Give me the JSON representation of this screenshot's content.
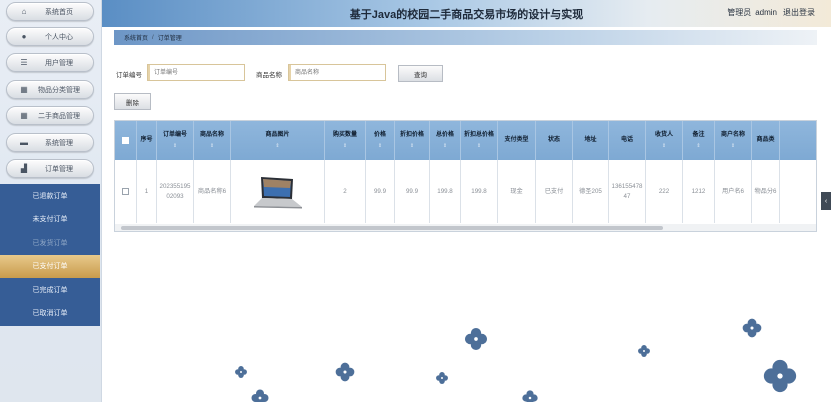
{
  "header": {
    "title": "基于Java的校园二手商品交易市场的设计与实现",
    "user_role": "管理员",
    "username": "admin",
    "logout": "退出登录"
  },
  "sidebar": {
    "items": [
      {
        "label": "系统首页",
        "icon": "home-icon"
      },
      {
        "label": "个人中心",
        "icon": "person-icon"
      },
      {
        "label": "用户管理",
        "icon": "list-icon"
      },
      {
        "label": "物品分类管理",
        "icon": "grid-icon"
      },
      {
        "label": "二手商品管理",
        "icon": "grid-icon"
      },
      {
        "label": "系统管理",
        "icon": "briefcase-icon"
      },
      {
        "label": "订单管理",
        "icon": "chart-icon"
      }
    ],
    "submenu": [
      {
        "label": "已退款订单"
      },
      {
        "label": "未支付订单"
      },
      {
        "label": "已发货订单"
      },
      {
        "label": "已支付订单"
      },
      {
        "label": "已完成订单"
      },
      {
        "label": "已取消订单"
      }
    ]
  },
  "breadcrumb": {
    "home": "系统首页",
    "separator": "/",
    "current": "订单管理"
  },
  "search": {
    "order_label": "订单编号",
    "order_placeholder": "订单编号",
    "name_label": "商品名称",
    "name_placeholder": "商品名称",
    "query_button": "查询",
    "delete_button": "删除"
  },
  "table": {
    "headers": [
      {
        "label": "",
        "sortable": false
      },
      {
        "label": "序号",
        "sortable": false
      },
      {
        "label": "订单编号",
        "sortable": true
      },
      {
        "label": "商品名称",
        "sortable": true
      },
      {
        "label": "商品图片",
        "sortable": true
      },
      {
        "label": "购买数量",
        "sortable": true
      },
      {
        "label": "价格",
        "sortable": true
      },
      {
        "label": "折扣价格",
        "sortable": true
      },
      {
        "label": "总价格",
        "sortable": true
      },
      {
        "label": "折扣总价格",
        "sortable": true
      },
      {
        "label": "支付类型",
        "sortable": false
      },
      {
        "label": "状态",
        "sortable": false
      },
      {
        "label": "地址",
        "sortable": false
      },
      {
        "label": "电话",
        "sortable": false
      },
      {
        "label": "收货人",
        "sortable": true
      },
      {
        "label": "备注",
        "sortable": true
      },
      {
        "label": "商户名称",
        "sortable": true
      },
      {
        "label": "商品类",
        "sortable": false
      }
    ],
    "sort_glyph": "⇕",
    "rows": [
      {
        "index": "1",
        "order_no": "20235519502093",
        "product_name": "商品名称6",
        "image": "laptop",
        "quantity": "2",
        "price": "99.9",
        "discount_price": "99.9",
        "total": "199.8",
        "discount_total": "199.8",
        "pay_type": "现金",
        "status": "已支付",
        "address": "德圣205",
        "phone": "13615547847",
        "receiver": "222",
        "remark": "1212",
        "merchant": "用户名6",
        "category": "物品分6"
      }
    ]
  },
  "colors": {
    "header_blue": "#5a8ec4",
    "sidebar_submenu": "#365d96",
    "active_gold": "#c89b4c",
    "table_header": "#8fb6dc",
    "clover": "#4d6f99"
  }
}
